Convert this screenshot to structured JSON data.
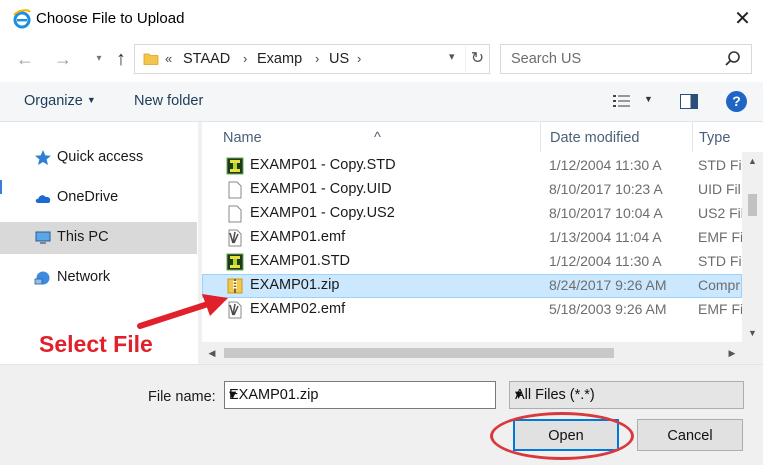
{
  "window": {
    "title": "Choose File to Upload",
    "app_icon": "ie-logo-icon",
    "close_glyph": "✕"
  },
  "address": {
    "overflow": "«",
    "crumbs": [
      "STAAD",
      "Examp",
      "US"
    ],
    "separator": "›"
  },
  "search": {
    "placeholder": "Search US"
  },
  "toolbar": {
    "organize": "Organize",
    "new_folder": "New folder",
    "help": "?"
  },
  "nav": {
    "items": [
      {
        "label": "Quick access",
        "icon": "star-icon"
      },
      {
        "label": "OneDrive",
        "icon": "cloud-icon"
      },
      {
        "label": "This PC",
        "icon": "computer-icon",
        "selected": true
      },
      {
        "label": "Network",
        "icon": "network-icon"
      }
    ]
  },
  "columns": {
    "name": "Name",
    "date": "Date modified",
    "type": "Type"
  },
  "files": [
    {
      "name": "EXAMP01 - Copy.STD",
      "date": "1/12/2004 11:30 A",
      "type": "STD Fil",
      "icon": "staad-file-icon"
    },
    {
      "name": "EXAMP01 - Copy.UID",
      "date": "8/10/2017 10:23 A",
      "type": "UID Fil",
      "icon": "generic-file-icon"
    },
    {
      "name": "EXAMP01 - Copy.US2",
      "date": "8/10/2017 10:04 A",
      "type": "US2 Fil",
      "icon": "generic-file-icon"
    },
    {
      "name": "EXAMP01.emf",
      "date": "1/13/2004 11:04 A",
      "type": "EMF Fil",
      "icon": "emf-file-icon"
    },
    {
      "name": "EXAMP01.STD",
      "date": "1/12/2004 11:30 A",
      "type": "STD Fil",
      "icon": "staad-file-icon"
    },
    {
      "name": "EXAMP01.zip",
      "date": "8/24/2017 9:26 AM",
      "type": "Compr",
      "icon": "zip-folder-icon",
      "selected": true
    },
    {
      "name": "EXAMP02.emf",
      "date": "5/18/2003 9:26 AM",
      "type": "EMF Fil",
      "icon": "emf-file-icon"
    }
  ],
  "bottom": {
    "file_name_label": "File name:",
    "file_name_value": "EXAMP01.zip",
    "filter_value": "All Files (*.*)",
    "open_label": "Open",
    "cancel_label": "Cancel"
  },
  "annotation": {
    "callout_text": "Select File",
    "color": "#e0202a"
  },
  "colors": {
    "selection_bg": "#cce8ff",
    "selection_border": "#99d1ff",
    "accent": "#0078d7"
  }
}
